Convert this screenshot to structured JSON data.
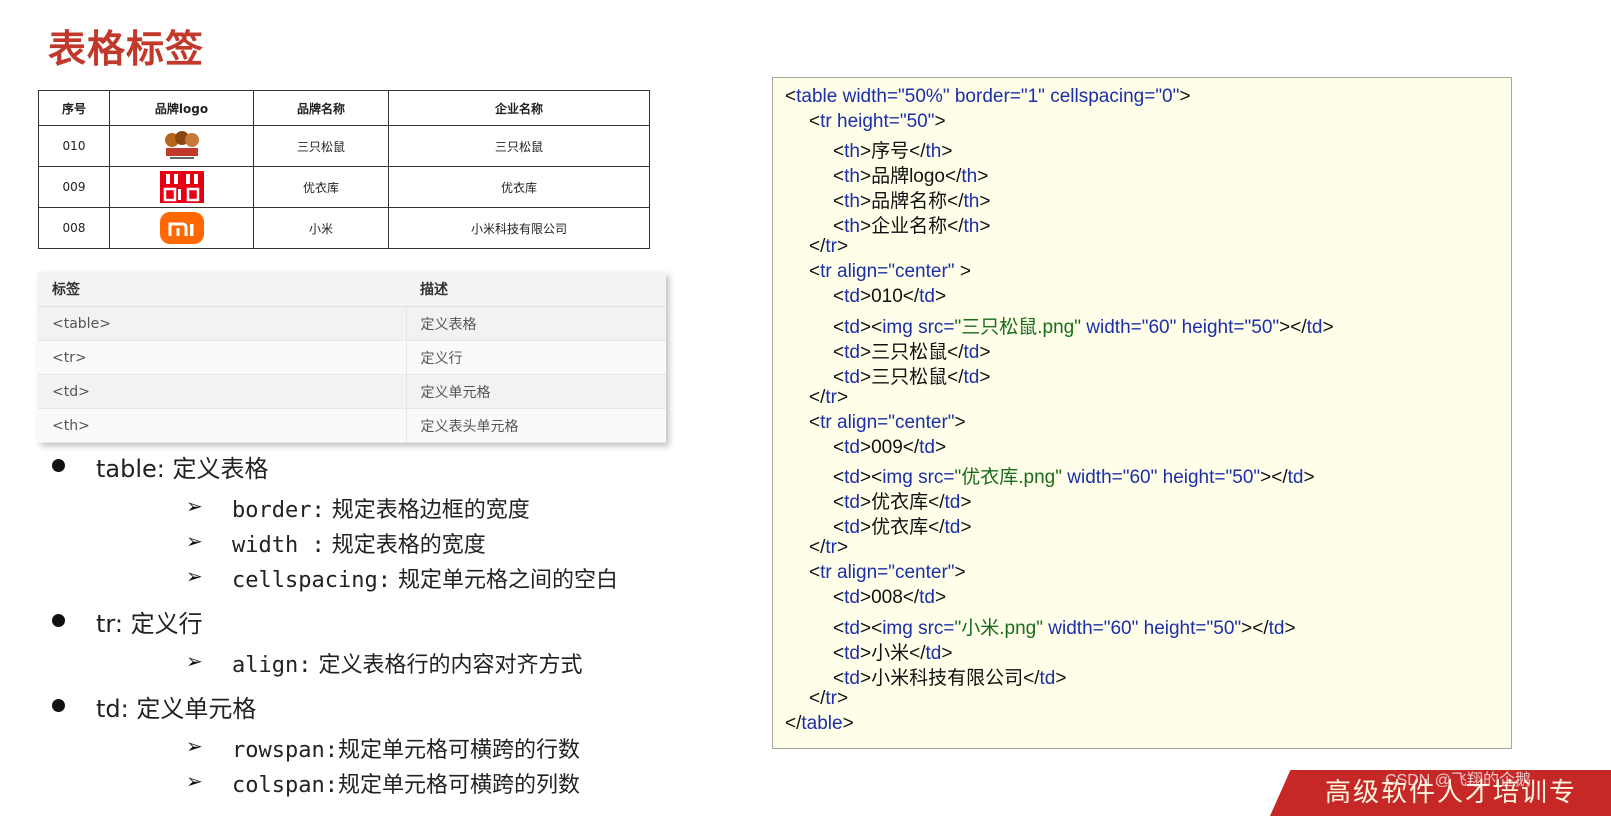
{
  "title": "表格标签",
  "brand_table": {
    "headers": [
      "序号",
      "品牌logo",
      "品牌名称",
      "企业名称"
    ],
    "rows": [
      {
        "id": "010",
        "logo": "三只松鼠",
        "name": "三只松鼠",
        "company": "三只松鼠"
      },
      {
        "id": "009",
        "logo": "UNIQLO",
        "name": "优衣库",
        "company": "优衣库"
      },
      {
        "id": "008",
        "logo": "mi",
        "name": "小米",
        "company": "小米科技有限公司"
      }
    ]
  },
  "tag_table": {
    "headers": [
      "标签",
      "描述"
    ],
    "rows": [
      {
        "tag": "<table>",
        "desc": "定义表格"
      },
      {
        "tag": "<tr>",
        "desc": "定义行"
      },
      {
        "tag": "<td>",
        "desc": "定义单元格"
      },
      {
        "tag": "<th>",
        "desc": "定义表头单元格"
      }
    ]
  },
  "bullets": {
    "table": "table: 定义表格",
    "table_subs": [
      {
        "code": "border:",
        "text": " 规定表格边框的宽度"
      },
      {
        "code": "width :",
        "text": " 规定表格的宽度"
      },
      {
        "code": "cellspacing:",
        "text": " 规定单元格之间的空白"
      }
    ],
    "tr": "tr: 定义行",
    "tr_subs": [
      {
        "code": "align:",
        "text": " 定义表格行的内容对齐方式"
      }
    ],
    "td": "td: 定义单元格",
    "td_subs": [
      {
        "code": "rowspan:",
        "text": "规定单元格可横跨的行数"
      },
      {
        "code": "colspan:",
        "text": "规定单元格可横跨的列数"
      }
    ]
  },
  "code": {
    "l1": "<table width=\"50%\" border=\"1\" cellspacing=\"0\">",
    "l2": "<tr height=\"50\">",
    "l3": "<th>序号</th>",
    "l4": "<th>品牌logo</th>",
    "l5": "<th>品牌名称</th>",
    "l6": "<th>企业名称</th>",
    "l7": "</tr>",
    "l8": "<tr align=\"center\" >",
    "l9": "<td>010</td>",
    "l10": "<td><img src=\"三只松鼠.png\" width=\"60\" height=\"50\"></td>",
    "l11": "<td>三只松鼠</td>",
    "l12": "<td>三只松鼠</td>",
    "l13": "</tr>",
    "l14": "<tr align=\"center\">",
    "l15": "<td>009</td>",
    "l16": "<td><img src=\"优衣库.png\"  width=\"60\" height=\"50\"></td>",
    "l17": "<td>优衣库</td>",
    "l18": "<td>优衣库</td>",
    "l19": "</tr>",
    "l20": "<tr align=\"center\">",
    "l21": "<td>008</td>",
    "l22": "<td><img src=\"小米.png\" width=\"60\" height=\"50\"></td>",
    "l23": "<td>小米</td>",
    "l24": "<td>小米科技有限公司</td>",
    "l25": "</tr>",
    "l26": "</table>"
  },
  "footer": {
    "ribbon_text": "高级软件人才培训专",
    "watermark": "CSDN @飞翔的企鹅"
  },
  "colors": {
    "title": "#c0392b",
    "code_tag": "#1c2ea8",
    "code_string": "#1b6b1b",
    "code_bg": "#fefee9",
    "ribbon": "#c62828"
  }
}
